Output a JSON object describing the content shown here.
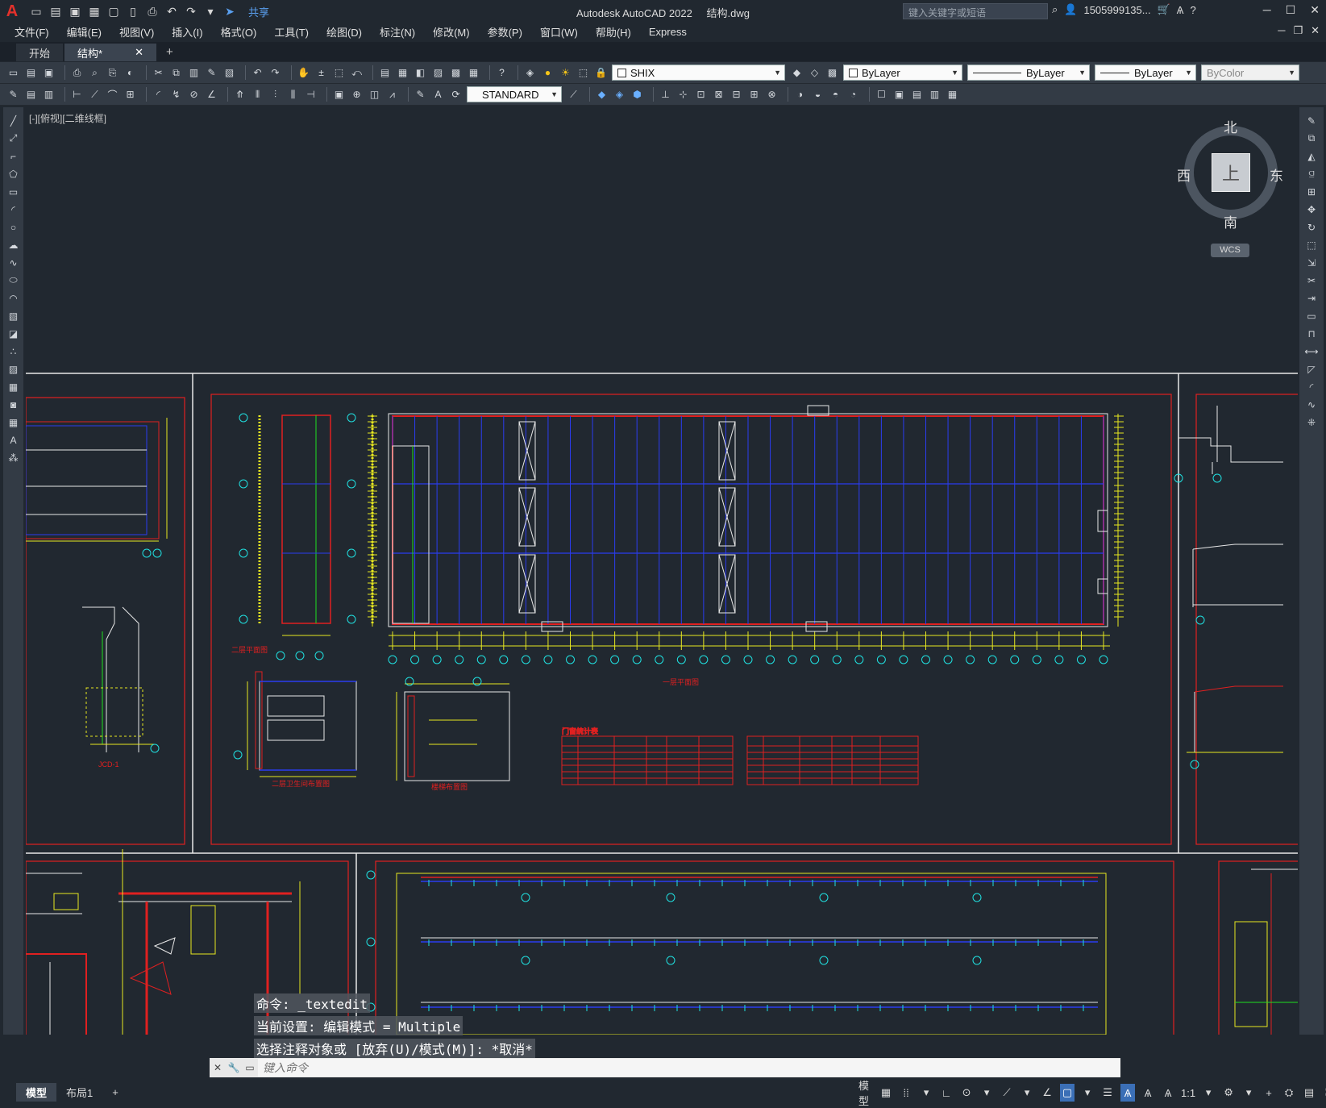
{
  "titlebar": {
    "app_logo": "A",
    "share_label": "共享",
    "app_name": "Autodesk AutoCAD 2022",
    "file_name": "结构.dwg",
    "search_placeholder": "键入关键字或短语",
    "user_name": "1505999135...",
    "help_glyph": "?"
  },
  "menus": [
    "文件(F)",
    "编辑(E)",
    "视图(V)",
    "插入(I)",
    "格式(O)",
    "工具(T)",
    "绘图(D)",
    "标注(N)",
    "修改(M)",
    "参数(P)",
    "窗口(W)",
    "帮助(H)",
    "Express"
  ],
  "tabs": [
    {
      "label": "开始",
      "active": false
    },
    {
      "label": "结构*",
      "active": true
    }
  ],
  "toolbar1": {
    "text_style": "SHIX",
    "layer": "ByLayer",
    "linetype": "ByLayer",
    "lineweight": "ByLayer",
    "color": "ByColor"
  },
  "toolbar2": {
    "dim_style": "STANDARD"
  },
  "viewport": {
    "label": "[-][俯视][二维线框]"
  },
  "viewcube": {
    "north": "北",
    "south": "南",
    "east": "东",
    "west": "西",
    "top_face": "上",
    "wcs_label": "WCS"
  },
  "command": {
    "history": [
      "命令: _textedit",
      "当前设置: 编辑模式 = Multiple",
      "选择注释对象或 [放弃(U)/模式(M)]: *取消*"
    ],
    "placeholder": "键入命令"
  },
  "layout_tabs": [
    {
      "label": "模型",
      "active": true
    },
    {
      "label": "布局1",
      "active": false
    }
  ],
  "statusbar": {
    "model_label": "模型",
    "scale_label": "1:1"
  },
  "drawing_labels": {
    "plan1": "一层平面图",
    "plan2": "二层平面图",
    "toilet": "二层卫生间布置图",
    "stair": "楼梯布置图",
    "door_table": "门窗统计表"
  },
  "colors": {
    "canvas_bg": "#212830",
    "frame_red": "#e02020",
    "line_yellow": "#e8e820",
    "line_blue": "#2b3cf0",
    "line_cyan": "#20e0e0",
    "line_white": "#e8e8e8",
    "line_green": "#20e020"
  }
}
